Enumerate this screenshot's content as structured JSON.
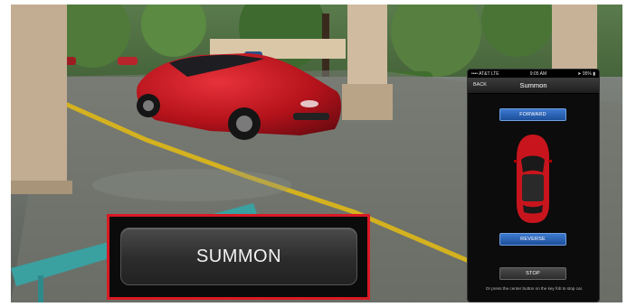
{
  "overlay": {
    "summon_button_label": "SUMMON"
  },
  "phone": {
    "status_bar": {
      "carrier": "AT&T",
      "network": "LTE",
      "time": "9:05 AM",
      "battery": "95%"
    },
    "nav": {
      "back_label": "BACK",
      "title": "Summon"
    },
    "forward_label": "FORWARD",
    "reverse_label": "REVERSE",
    "stop_label": "STOP",
    "hint": "Or press the center button on the key fob to stop car."
  },
  "colors": {
    "highlight_border": "#d91a23",
    "car_red": "#c8151d",
    "button_blue": "#2a63b8"
  }
}
